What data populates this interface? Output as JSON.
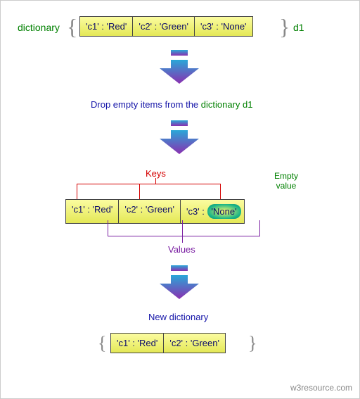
{
  "labels": {
    "dictionary": "dictionary",
    "d1": "d1",
    "step1": "Drop empty items from the",
    "step1_dictref": "dictionary d1",
    "keys": "Keys",
    "values": "Values",
    "empty_value": "Empty\nvalue",
    "new_dict": "New dictionary",
    "footer": "w3resource.com"
  },
  "top_cells": [
    "'c1' : 'Red'",
    "'c2' : 'Green'",
    "'c3' : 'None'"
  ],
  "mid_cells": {
    "c1": "'c1' : 'Red'",
    "c2": "'c2' : 'Green'",
    "c3_key": "'c3' :",
    "c3_none": "'None'"
  },
  "result_cells": [
    "'c1' : 'Red'",
    "'c2' : 'Green'"
  ]
}
